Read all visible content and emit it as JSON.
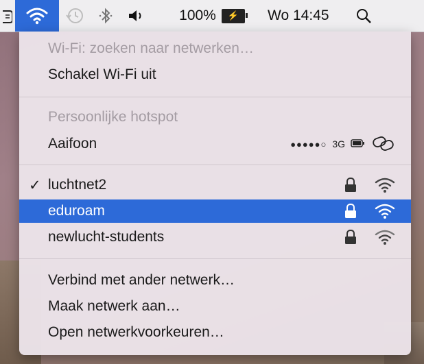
{
  "menubar": {
    "battery_percent": "100%",
    "battery_icon_text": "⚡",
    "clock": "Wo 14:45",
    "icons": [
      "script-icon",
      "wifi-icon",
      "time-machine-icon",
      "bluetooth-icon",
      "volume-icon",
      "battery-icon",
      "spotlight-search-icon"
    ]
  },
  "wifi_menu": {
    "status": "Wi-Fi: zoeken naar netwerken…",
    "toggle": "Schakel Wi-Fi uit",
    "hotspot_header": "Persoonlijke hotspot",
    "hotspot": {
      "name": "Aaifoon",
      "signal_dots": "●●●●●○",
      "network_type": "3G"
    },
    "networks": [
      {
        "name": "luchtnet2",
        "checked": true,
        "locked": true
      },
      {
        "name": "eduroam",
        "checked": false,
        "locked": true,
        "highlighted": true
      },
      {
        "name": "newlucht-students",
        "checked": false,
        "locked": true
      }
    ],
    "check_mark": "✓",
    "actions": [
      "Verbind met ander netwerk…",
      "Maak netwerk aan…",
      "Open netwerkvoorkeuren…"
    ]
  },
  "colors": {
    "highlight": "#2d6ad8",
    "menu_bg": "#ece4ea",
    "disabled_text": "#a49ca3"
  }
}
